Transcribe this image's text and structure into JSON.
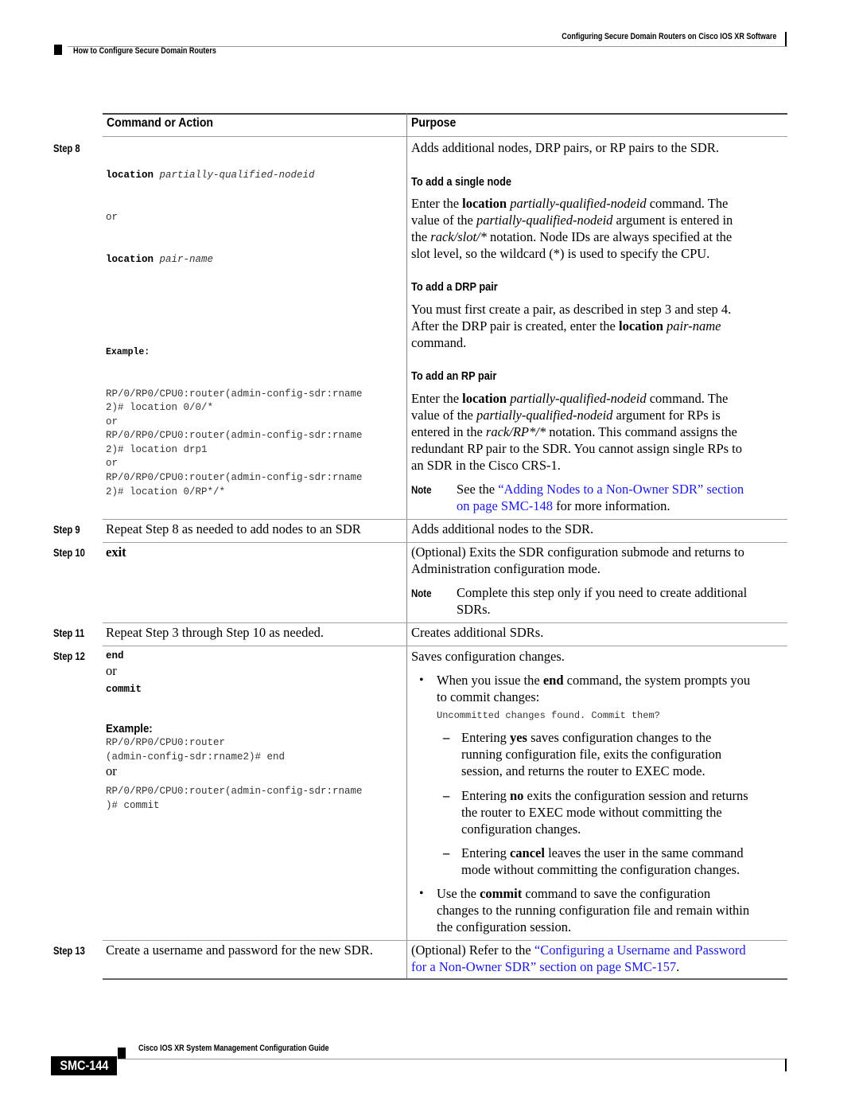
{
  "header": {
    "chapter_title": "Configuring Secure Domain Routers on Cisco IOS XR Software",
    "section_title": "How to Configure Secure Domain Routers"
  },
  "table": {
    "col_command": "Command or Action",
    "col_purpose": "Purpose",
    "steps": [
      {
        "label": "Step 8",
        "command": {
          "kw1": "location",
          "arg1": "partially-qualified-nodeid",
          "or1": "or",
          "kw2": "location",
          "arg2": "pair-name",
          "example_label": "Example:",
          "example_lines": [
            "RP/0/RP0/CPU0:router(admin-config-sdr:rname",
            "2)# location 0/0/*",
            "or",
            "RP/0/RP0/CPU0:router(admin-config-sdr:rname",
            "2)# location drp1",
            "or",
            "RP/0/RP0/CPU0:router(admin-config-sdr:rname",
            "2)# location 0/RP*/*"
          ]
        },
        "purpose": {
          "intro": "Adds additional nodes, DRP pairs, or RP pairs to the SDR.",
          "single_node_heading": "To add a single node",
          "single_node_lines": [
            "Enter the <b>location</b> <i>partially-qualified-nodeid</i> command. The",
            "value of the <i>partially-qualified-nodeid</i> argument is entered in",
            "the <i>rack/slot/*</i> notation. Node IDs are always specified at the",
            "slot level, so the wildcard (*) is used to specify the CPU."
          ],
          "drp_heading": "To add a DRP pair",
          "drp_lines": [
            "You must first create a pair, as described in step 3 and step 4.",
            "After the DRP pair is created, enter the <b>location</b> <i>pair-name</i>",
            "command."
          ],
          "rp_heading": "To add an RP pair",
          "rp_lines": [
            "Enter the <b>location</b> <i>partially-qualified-nodeid</i> command. The",
            "value of the <i>partially-qualified-nodeid</i> argument for RPs is",
            "entered in the <i>rack/RP*/*</i> notation. This command assigns the",
            "redundant RP pair to the SDR. You cannot assign single RPs to",
            "an SDR in the Cisco CRS-1."
          ],
          "note_label": "Note",
          "note_prefix": "See the ",
          "note_link_line1": "“Adding Nodes to a Non-Owner SDR” section",
          "note_link_line2": "on page SMC-148",
          "note_suffix": " for more information."
        }
      },
      {
        "label": "Step 9",
        "command_text": "Repeat Step 8 as needed to add nodes to an SDR",
        "purpose_text": "Adds additional nodes to the SDR."
      },
      {
        "label": "Step 10",
        "command_text": "exit",
        "purpose_lines": [
          "(Optional) Exits the SDR configuration submode and returns to",
          "Administration configuration mode."
        ],
        "note_label": "Note",
        "note_lines": [
          "Complete this step only if you need to create additional",
          "SDRs."
        ]
      },
      {
        "label": "Step 11",
        "command_text": "Repeat Step 3 through Step 10 as needed.",
        "purpose_text": "Creates additional SDRs."
      },
      {
        "label": "Step 12",
        "command": {
          "kw1": "end",
          "or1": "or",
          "kw2": "commit",
          "example_label": "Example:",
          "example_lines_a": [
            "RP/0/RP0/CPU0:router",
            "(admin-config-sdr:rname2)# end"
          ],
          "or2": "or",
          "example_lines_b": [
            "RP/0/RP0/CPU0:router(admin-config-sdr:rname",
            ")# commit"
          ]
        },
        "purpose": {
          "intro": "Saves configuration changes.",
          "bullet1_lines": [
            "When you issue the <b>end</b> command, the system prompts you",
            "to commit changes:"
          ],
          "prompt_code": "Uncommitted changes found. Commit them?",
          "dash_yes_lines": [
            "Entering <b>yes</b> saves configuration changes to the",
            "running configuration file, exits the configuration",
            "session, and returns the router to EXEC mode."
          ],
          "dash_no_lines": [
            "Entering <b>no</b> exits the configuration session and returns",
            "the router to EXEC mode without committing the",
            "configuration changes."
          ],
          "dash_cancel_lines": [
            "Entering <b>cancel</b> leaves the user in the same command",
            "mode without committing the configuration changes."
          ],
          "bullet2_lines": [
            "Use the <b>commit</b> command to save the configuration",
            "changes to the running configuration file and remain within",
            "the configuration session."
          ]
        }
      },
      {
        "label": "Step 13",
        "command_text": "Create a username and password for the new SDR.",
        "purpose_prefix": "(Optional) Refer to the ",
        "purpose_link_line1": "“Configuring a Username and Password",
        "purpose_link_line2": "for a Non-Owner SDR” section on page SMC-157",
        "purpose_suffix": "."
      }
    ]
  },
  "footer": {
    "guide_title": "Cisco IOS XR System Management Configuration Guide",
    "page_number": "SMC-144"
  },
  "colors": {
    "link": "#1a1ae6",
    "text": "#000000",
    "code": "#333333"
  }
}
